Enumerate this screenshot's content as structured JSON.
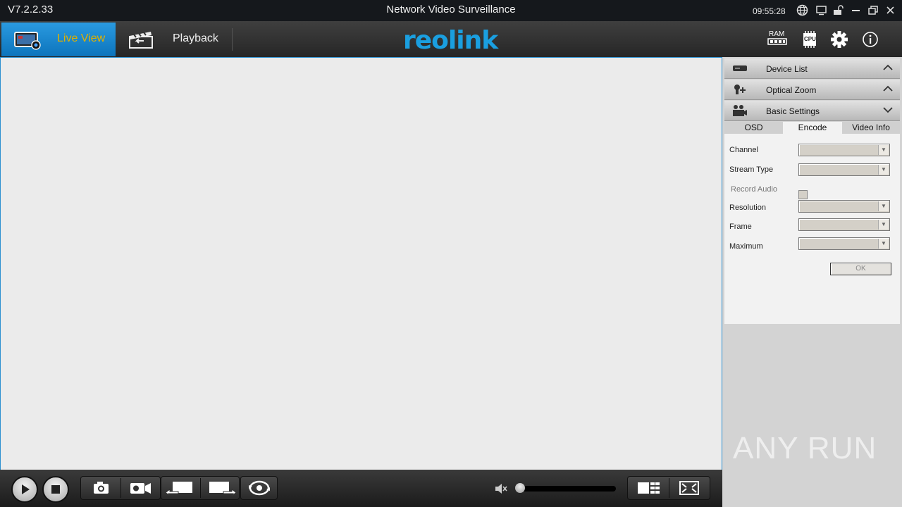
{
  "titlebar": {
    "version": "V7.2.2.33",
    "title": "Network Video Surveillance",
    "clock": "09:55:28",
    "icons": [
      "globe-icon",
      "monitor-icon",
      "lock-icon",
      "minimize-icon",
      "restore-icon",
      "close-icon"
    ]
  },
  "nav": {
    "live_view": "Live View",
    "playback": "Playback",
    "logo": "reolink",
    "header_icons": [
      "ram-icon",
      "cpu-icon",
      "gear-icon",
      "info-icon"
    ],
    "ram_label": "RAM",
    "cpu_label": "CPU"
  },
  "panel": {
    "sections": [
      {
        "label": "Device List",
        "icon": "device-list-icon",
        "state": "collapsed"
      },
      {
        "label": "Optical Zoom",
        "icon": "optical-zoom-icon",
        "state": "collapsed"
      },
      {
        "label": "Basic Settings",
        "icon": "basic-settings-icon",
        "state": "expanded"
      }
    ],
    "tabs": [
      "OSD",
      "Encode",
      "Video Info"
    ],
    "active_tab": "Encode",
    "fields": {
      "channel": "Channel",
      "stream_type": "Stream Type",
      "record_audio": "Record Audio",
      "resolution": "Resolution",
      "frame": "Frame",
      "maximum": "Maximum"
    },
    "ok": "OK"
  },
  "watermark": "ANY RUN",
  "colors": {
    "accent": "#1a9fe0",
    "live_label": "#e0b000",
    "video_bg": "#ebebeb"
  }
}
